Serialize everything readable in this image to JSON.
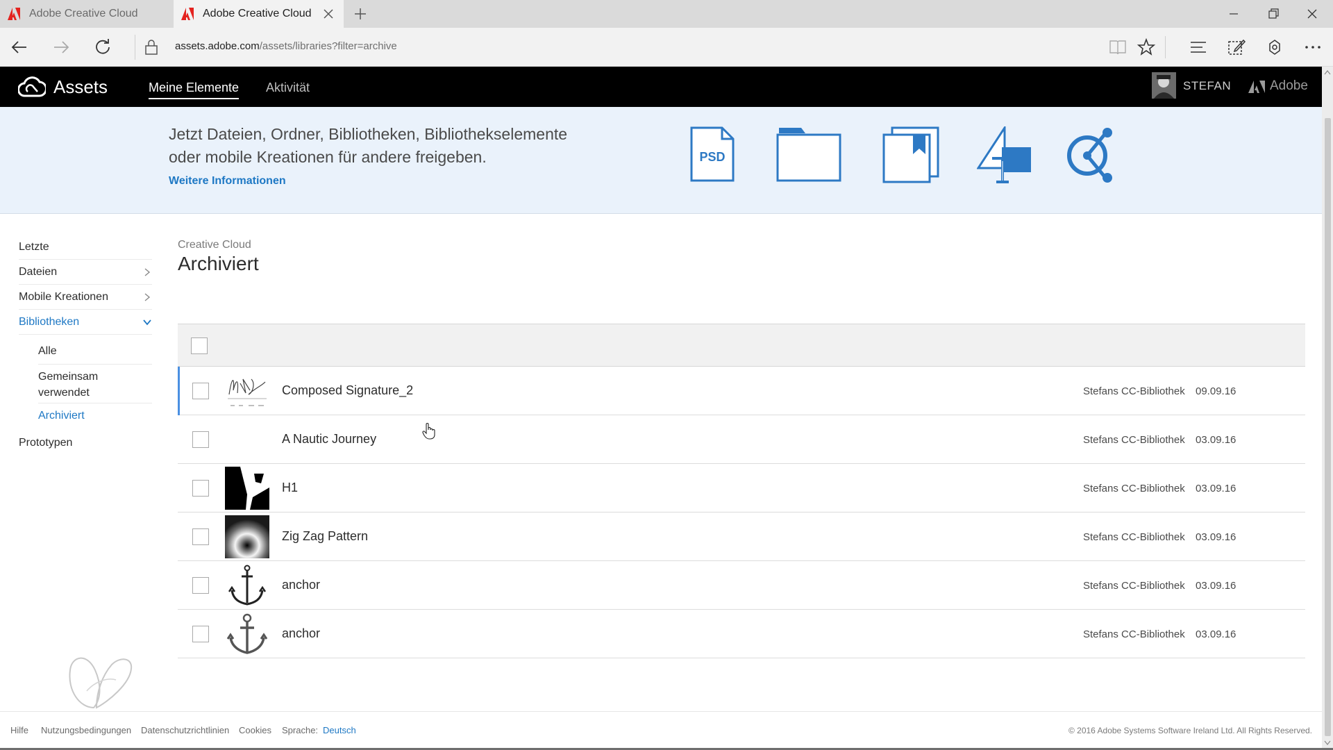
{
  "browser": {
    "tabs": [
      {
        "title": "Adobe Creative Cloud",
        "active": false
      },
      {
        "title": "Adobe Creative Cloud",
        "active": true
      }
    ],
    "url_host": "assets.adobe.com",
    "url_path": "/assets/libraries?filter=archive"
  },
  "header": {
    "app_title": "Assets",
    "nav": [
      "Meine Elemente",
      "Aktivität"
    ],
    "user_name": "STEFAN",
    "brand": "Adobe"
  },
  "promo": {
    "line1": "Jetzt Dateien, Ordner, Bibliotheken, Bibliothekselemente",
    "line2": "oder mobile Kreationen für andere freigeben.",
    "link": "Weitere Informationen",
    "psd_label": "PSD"
  },
  "sidebar": {
    "items": [
      "Letzte",
      "Dateien",
      "Mobile Kreationen",
      "Bibliotheken",
      "Prototypen"
    ],
    "sub_items": [
      "Alle",
      "Gemeinsam verwendet",
      "Archiviert"
    ]
  },
  "main": {
    "breadcrumb": "Creative Cloud",
    "title": "Archiviert",
    "rows": [
      {
        "name": "Composed Signature_2",
        "library": "Stefans CC-Bibliothek",
        "date": "09.09.16"
      },
      {
        "name": "A Nautic Journey",
        "library": "Stefans CC-Bibliothek",
        "date": "03.09.16"
      },
      {
        "name": "H1",
        "library": "Stefans CC-Bibliothek",
        "date": "03.09.16"
      },
      {
        "name": "Zig Zag Pattern",
        "library": "Stefans CC-Bibliothek",
        "date": "03.09.16"
      },
      {
        "name": "anchor",
        "library": "Stefans CC-Bibliothek",
        "date": "03.09.16"
      },
      {
        "name": "anchor",
        "library": "Stefans CC-Bibliothek",
        "date": "03.09.16"
      }
    ]
  },
  "footer": {
    "links": [
      "Hilfe",
      "Nutzungsbedingungen",
      "Datenschutzrichtlinien",
      "Cookies"
    ],
    "language_label": "Sprache:",
    "language": "Deutsch",
    "copyright": "© 2016 Adobe Systems Software Ireland Ltd. All Rights Reserved."
  },
  "colors": {
    "accent": "#1e78c4",
    "header_bg": "#000000",
    "promo_bg": "#eaf2fb",
    "adobe_red": "#e4231f"
  }
}
